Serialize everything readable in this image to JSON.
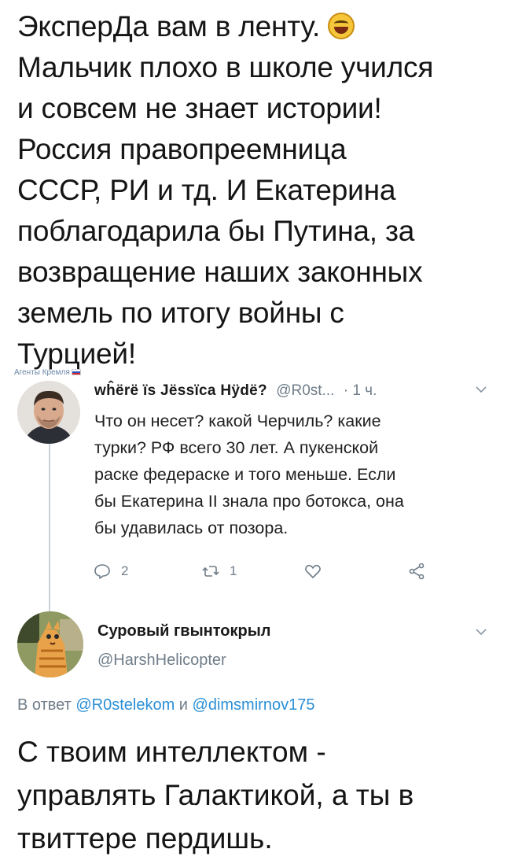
{
  "caption": {
    "lines": [
      "ЭксперДа вам в ленту.",
      "Мальчик плохо в школе учился",
      "и совсем не знает истории!",
      "Россия правопреемница",
      "СССР, РИ и тд. И Екатерина",
      "поблагодарила бы Путина, за",
      "возвращение наших законных",
      "земель по итогу войны с",
      "Турцией!"
    ],
    "emoji": "face-with-tears-of-joy"
  },
  "watermark": {
    "text": "Агенты Кремля",
    "flag": "russian-flag"
  },
  "tweet1": {
    "name": "wĥërë ïs Jëssïca Hÿdë?",
    "handle": "@R0st...",
    "time": "· 1 ч.",
    "body_lines": [
      "Что он несет? какой Черчиль? какие",
      "турки? РФ всего 30 лет. А пукенской",
      "раске федераске и того меньше. Если",
      "бы Екатерина II знала про ботокса, она",
      "бы удавилась от позора."
    ],
    "actions": {
      "reply_count": "2",
      "retweet_count": "1"
    }
  },
  "tweet2": {
    "name": "Суровый гвынтокрыл",
    "handle": "@HarshHelicopter",
    "reply_prefix": "В ответ",
    "mention1": "@R0stelekom",
    "reply_and": "и",
    "mention2": "@dimsmirnov175",
    "body_lines": [
      "С твоим интеллектом -",
      "управлять Галактикой, а ты в",
      "твиттере пердишь."
    ]
  },
  "colors": {
    "text": "#141414",
    "secondary": "#6f7d89",
    "link": "#2b8fd6",
    "thread_line": "#c9d2da"
  }
}
